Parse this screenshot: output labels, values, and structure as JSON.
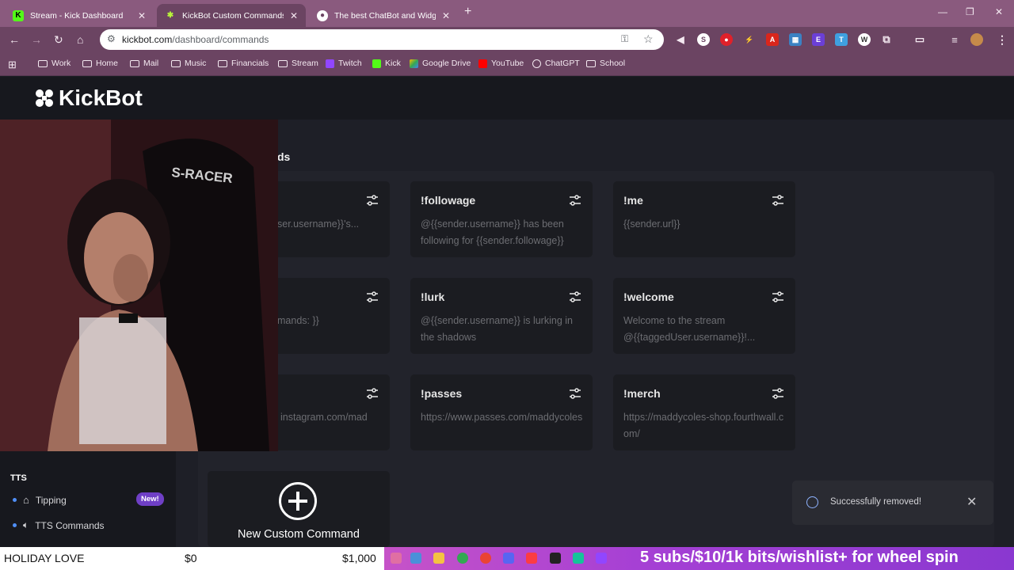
{
  "browser": {
    "tabs": [
      {
        "title": "Stream - Kick Dashboard",
        "favicon": "kick-icon"
      },
      {
        "title": "KickBot Custom Commands",
        "favicon": "kickbot-icon"
      },
      {
        "title": "The best ChatBot and Widgets",
        "favicon": "botrix-icon"
      }
    ],
    "url_domain": "kickbot.com",
    "url_path": "/dashboard/commands",
    "bookmarks": [
      "Work",
      "Home",
      "Mail",
      "Music",
      "Financials",
      "Stream",
      "Twitch",
      "Kick",
      "Google Drive",
      "YouTube",
      "ChatGPT",
      "School"
    ]
  },
  "app": {
    "logo_text": "KickBot",
    "section_title_fragment": "ds"
  },
  "commands": [
    {
      "name": "",
      "desc": "ser.username}}'s..."
    },
    {
      "name": "!followage",
      "desc": "@{{sender.username}} has been following for {{sender.followage}}"
    },
    {
      "name": "!me",
      "desc": "{{sender.url}}"
    },
    {
      "name": "",
      "desc": "mands: }}"
    },
    {
      "name": "!lurk",
      "desc": "@{{sender.username}} is lurking in the shadows"
    },
    {
      "name": "!welcome",
      "desc": "Welcome to the stream @{{taggedUser.username}}!..."
    },
    {
      "name": "",
      "desc": "instagram.com/mad"
    },
    {
      "name": "!passes",
      "desc": "https://www.passes.com/maddycoles"
    },
    {
      "name": "!merch",
      "desc": "https://maddycoles-shop.fourthwall.com/"
    }
  ],
  "new_command_label": "New Custom Command",
  "sidebar": {
    "section": "TTS",
    "items": [
      {
        "label": "Tipping",
        "badge": "New!"
      },
      {
        "label": "TTS Commands"
      }
    ]
  },
  "toast": {
    "message": "Successfully removed!"
  },
  "stream_overlay": {
    "goal_label": "HOLIDAY LOVE",
    "goal_current": "$0",
    "goal_target": "$1,000",
    "ticker": "5 subs/$10/1k bits/wishlist+ for wheel spin"
  }
}
